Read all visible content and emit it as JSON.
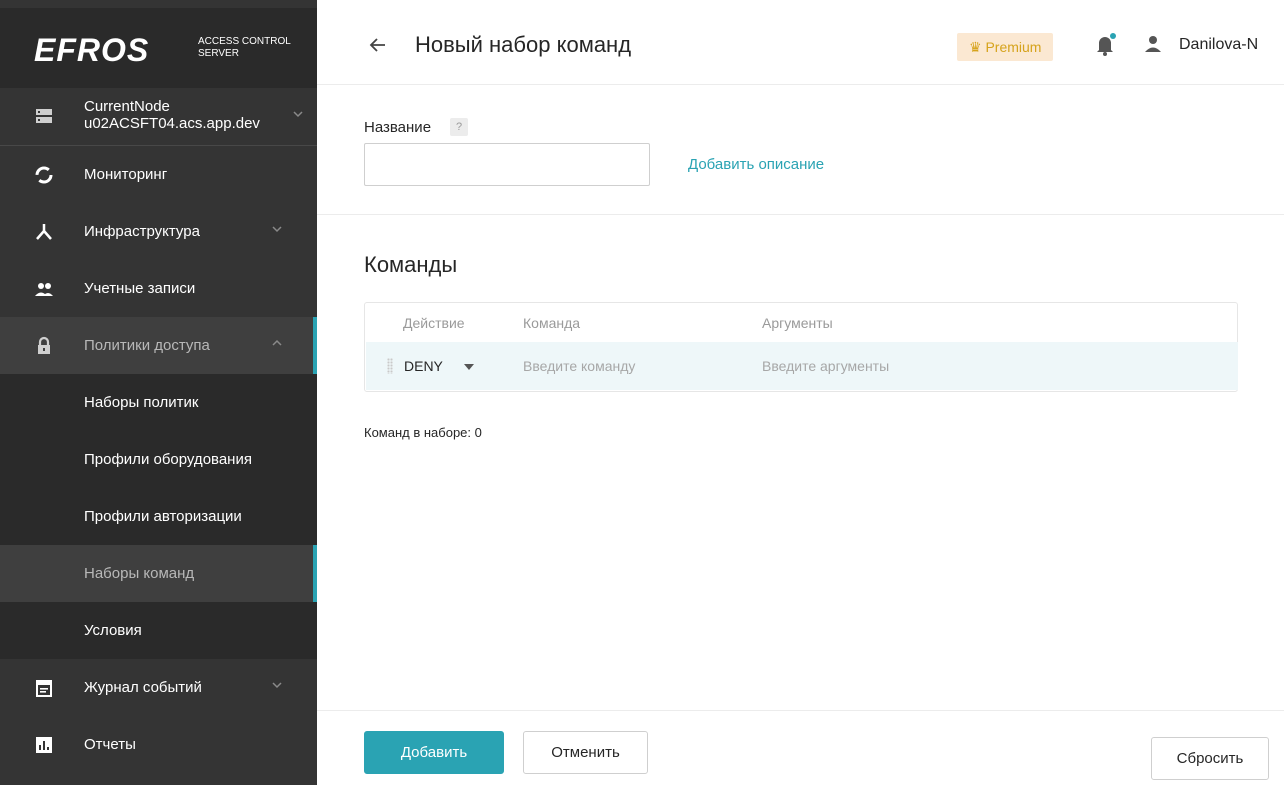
{
  "sidebar": {
    "logo": {
      "mark": "EFROS",
      "sub_line1": "ACCESS CONTROL",
      "sub_line2": "SERVER"
    },
    "node": {
      "name": "CurrentNode",
      "host": "u02ACSFT04.acs.app.dev"
    },
    "items": [
      {
        "label": "Мониторинг",
        "icon": "monitoring-icon"
      },
      {
        "label": "Инфраструктура",
        "icon": "infrastructure-icon",
        "expandable": true
      },
      {
        "label": "Учетные записи",
        "icon": "accounts-icon"
      },
      {
        "label": "Политики доступа",
        "icon": "lock-icon",
        "expanded": true
      },
      {
        "label": "Наборы политик"
      },
      {
        "label": "Профили оборудования"
      },
      {
        "label": "Профили авторизации"
      },
      {
        "label": "Наборы команд",
        "active": true
      },
      {
        "label": "Условия"
      },
      {
        "label": "Журнал событий",
        "icon": "event-log-icon",
        "expandable": true
      },
      {
        "label": "Отчеты",
        "icon": "reports-icon"
      }
    ],
    "accent": "#2aa3b3"
  },
  "header": {
    "title": "Новый набор команд",
    "premium": "Premium",
    "user": "Danilova-N"
  },
  "form": {
    "name_label": "Название",
    "help": "?",
    "name_value": "",
    "add_description": "Добавить описание"
  },
  "commands": {
    "title": "Команды",
    "columns": [
      "Действие",
      "Команда",
      "Аргументы"
    ],
    "row": {
      "action": "DENY",
      "command_placeholder": "Введите команду",
      "args_placeholder": "Введите аргументы"
    },
    "count_text": "Команд в наборе: 0"
  },
  "footer": {
    "add": "Добавить",
    "cancel": "Отменить",
    "reset": "Сбросить"
  }
}
